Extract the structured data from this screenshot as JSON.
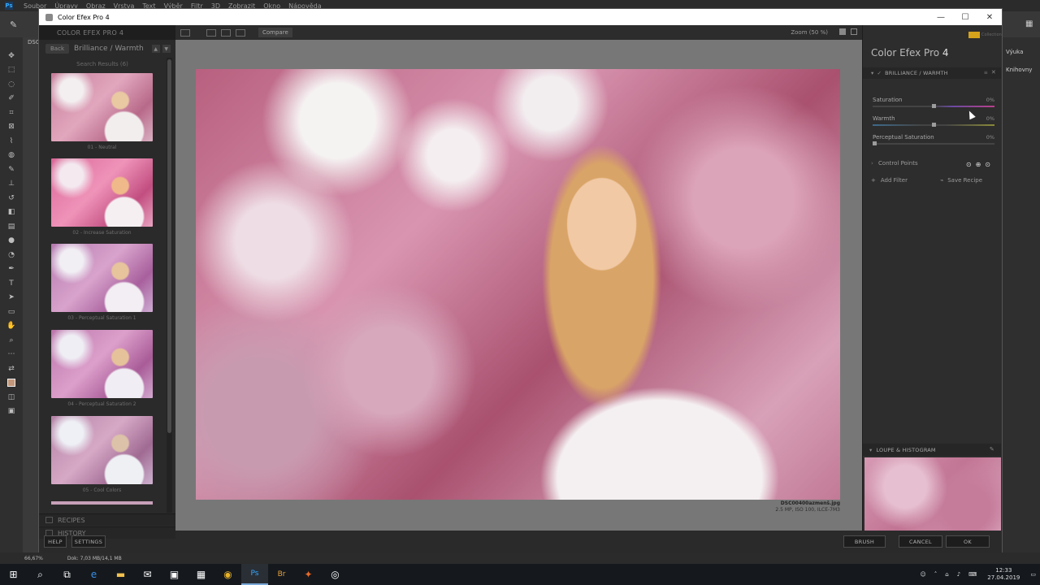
{
  "photoshop": {
    "menu": [
      "Soubor",
      "Úpravy",
      "Obraz",
      "Vrstva",
      "Text",
      "Výběr",
      "Filtr",
      "3D",
      "Zobrazit",
      "Okno",
      "Nápověda"
    ],
    "doc_tab": "DSC",
    "right_panels": [
      "Výuka",
      "Knihovny"
    ],
    "status_zoom": "66,67%",
    "status_doc": "Dok: 7,03 MB/14,1 MB"
  },
  "window": {
    "title": "Color Efex Pro 4"
  },
  "left_panel": {
    "header": "COLOR EFEX PRO 4",
    "back_label": "Back",
    "nav_title": "Brilliance / Warmth",
    "search_results": "Search Results (6)",
    "presets": [
      {
        "label": "01 - Neutral"
      },
      {
        "label": "02 - Increase Saturation"
      },
      {
        "label": "03 - Perceptual Saturation 1"
      },
      {
        "label": "04 - Perceptual Saturation 2"
      },
      {
        "label": "05 - Cool Colors"
      }
    ],
    "recipes_label": "RECIPES",
    "history_label": "HISTORY",
    "help_label": "HELP",
    "settings_label": "SETTINGS"
  },
  "toolbar": {
    "compare_label": "Compare",
    "zoom_label": "Zoom (50 %)"
  },
  "image_info": {
    "filename": "DSC00400azmenš.jpg",
    "meta": "2.5 MP, ISO 100, ILCE-7M3"
  },
  "right_panel": {
    "brand": "Collection",
    "title": "Color Efex Pro",
    "title_num": "4",
    "filter_name": "BRILLIANCE / WARMTH",
    "sliders": [
      {
        "label": "Saturation",
        "value": "0%",
        "level": 0.5
      },
      {
        "label": "Warmth",
        "value": "0%",
        "level": 0.5
      },
      {
        "label": "Perceptual Saturation",
        "value": "0%",
        "level": 0.0
      }
    ],
    "control_points_label": "Control Points",
    "add_filter_label": "Add Filter",
    "save_recipe_label": "Save Recipe",
    "loupe_label": "LOUPE & HISTOGRAM"
  },
  "actions": {
    "brush_label": "BRUSH",
    "cancel_label": "CANCEL",
    "ok_label": "OK"
  },
  "taskbar": {
    "time": "12:33",
    "date": "27.04.2019"
  }
}
